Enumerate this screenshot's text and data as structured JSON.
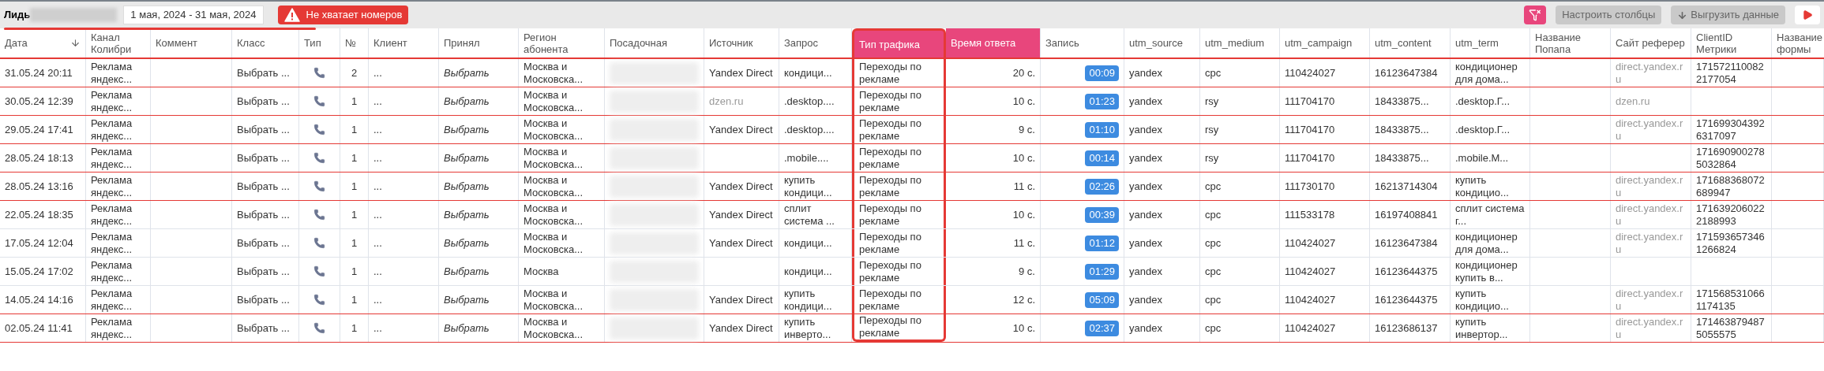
{
  "toolbar": {
    "title": "Лидь",
    "underlined": true,
    "period": "1 мая, 2024 - 31 мая, 2024",
    "alert": "Не хватает номеров",
    "buttons": [
      {
        "kind": "filter-clear"
      },
      {
        "kind": "text",
        "label": "Настроить столбцы"
      },
      {
        "kind": "download",
        "label": "Выгрузить данные"
      },
      {
        "kind": "play"
      }
    ]
  },
  "table": {
    "columns": [
      {
        "label": "Дата",
        "kind": "text",
        "sorted": true
      },
      {
        "label": "Канал Колибри",
        "kind": "text"
      },
      {
        "label": "Коммент"
      },
      {
        "label": "Класс",
        "kind": "text"
      },
      {
        "label": "Тип"
      },
      {
        "label": "№",
        "kind": "number"
      },
      {
        "label": "Клиент",
        "kind": "text"
      },
      {
        "label": "Принял",
        "kind": "italic"
      },
      {
        "label": "Регион абонента",
        "kind": "text"
      },
      {
        "label": "Посадочная"
      },
      {
        "label": "Источник",
        "kind": "text"
      },
      {
        "label": "Запрос",
        "kind": "text"
      },
      {
        "label": "Тип трафика",
        "kind": "text",
        "highlighted": true,
        "framed": true
      },
      {
        "label": "Время ответа",
        "kind": "right",
        "highlighted": true
      },
      {
        "label": "Запись",
        "kind": "record"
      },
      {
        "label": "utm_source",
        "kind": "text"
      },
      {
        "label": "utm_medium",
        "kind": "text"
      },
      {
        "label": "utm_campaign",
        "kind": "text"
      },
      {
        "label": "utm_content",
        "kind": "text"
      },
      {
        "label": "utm_term",
        "kind": "text"
      },
      {
        "label": "Название Попапа"
      },
      {
        "label": "Сайт реферер",
        "kind": "muted"
      },
      {
        "label": "ClientID Метрики",
        "kind": "break"
      },
      {
        "label": "Название формы"
      }
    ],
    "rows": [
      {
        "marked": true,
        "cells": [
          "31.05.24 20:11",
          "Реклама яндекс...",
          {
            "kind": "blank"
          },
          "Выбрать ...",
          {
            "kind": "phone"
          },
          "2",
          "...",
          "Выбрать",
          "Москва и Московска...",
          {
            "kind": "redacted"
          },
          "Yandex Direct",
          "кондици...",
          "Переходы по рекламе",
          "20 с.",
          "00:09",
          "yandex",
          "cpc",
          "110424027",
          "16123647384",
          "кондиционер для дома...",
          {
            "kind": "blank"
          },
          "direct.yandex.ru",
          "1715721100822177054",
          {
            "kind": "blank"
          }
        ]
      },
      {
        "marked": true,
        "cells": [
          "30.05.24 12:39",
          "Реклама яндекс...",
          {
            "kind": "blank"
          },
          "Выбрать ...",
          {
            "kind": "phone"
          },
          "1",
          "...",
          "Выбрать",
          "Москва и Московска...",
          {
            "kind": "redacted"
          },
          {
            "kind": "muted",
            "text": "dzen.ru"
          },
          ".desktop....",
          "Переходы по рекламе",
          "10 с.",
          "01:23",
          "yandex",
          "rsy",
          "111704170",
          "18433875...",
          ".desktop.Г...",
          {
            "kind": "blank"
          },
          "dzen.ru",
          {
            "kind": "blank"
          },
          {
            "kind": "blank"
          }
        ]
      },
      {
        "marked": true,
        "cells": [
          "29.05.24 17:41",
          "Реклама яндекс...",
          {
            "kind": "blank"
          },
          "Выбрать ...",
          {
            "kind": "phone"
          },
          "1",
          "...",
          "Выбрать",
          "Москва и Московска...",
          {
            "kind": "redacted"
          },
          "Yandex Direct",
          ".desktop....",
          "Переходы по рекламе",
          "9 с.",
          "01:10",
          "yandex",
          "rsy",
          "111704170",
          "18433875...",
          ".desktop.Г...",
          {
            "kind": "blank"
          },
          "direct.yandex.ru",
          "1716993043926317097",
          {
            "kind": "blank"
          }
        ]
      },
      {
        "marked": true,
        "cells": [
          "28.05.24 18:13",
          "Реклама яндекс...",
          {
            "kind": "blank"
          },
          "Выбрать ...",
          {
            "kind": "phone"
          },
          "1",
          "...",
          "Выбрать",
          "Москва и Московска...",
          {
            "kind": "redacted"
          },
          {
            "kind": "blank"
          },
          ".mobile....",
          "Переходы по рекламе",
          "10 с.",
          "00:14",
          "yandex",
          "rsy",
          "111704170",
          "18433875...",
          ".mobile.M...",
          {
            "kind": "blank"
          },
          {
            "kind": "blank"
          },
          "1716909002785032864",
          {
            "kind": "blank"
          }
        ]
      },
      {
        "marked": true,
        "cells": [
          "28.05.24 13:16",
          "Реклама яндекс...",
          {
            "kind": "blank"
          },
          "Выбрать ...",
          {
            "kind": "phone"
          },
          "1",
          "...",
          "Выбрать",
          "Москва и Московска...",
          {
            "kind": "redacted"
          },
          "Yandex Direct",
          "купить кондици...",
          "Переходы по рекламе",
          "11 с.",
          "02:26",
          "yandex",
          "cpc",
          "111730170",
          "16213714304",
          "купить кондицио...",
          {
            "kind": "blank"
          },
          "direct.yandex.ru",
          "171688368072689947",
          {
            "kind": "blank"
          }
        ]
      },
      {
        "marked": false,
        "cells": [
          "22.05.24 18:35",
          "Реклама яндекс...",
          {
            "kind": "blank"
          },
          "Выбрать ...",
          {
            "kind": "phone"
          },
          "1",
          "...",
          "Выбрать",
          "Москва и Московска...",
          {
            "kind": "redacted"
          },
          "Yandex Direct",
          "сплит система ...",
          "Переходы по рекламе",
          "10 с.",
          "00:39",
          "yandex",
          "cpc",
          "111533178",
          "16197408841",
          "сплит система г...",
          {
            "kind": "blank"
          },
          "direct.yandex.ru",
          "1716392060222188993",
          {
            "kind": "blank"
          }
        ]
      },
      {
        "marked": false,
        "cells": [
          "17.05.24 12:04",
          "Реклама яндекс...",
          {
            "kind": "blank"
          },
          "Выбрать ...",
          {
            "kind": "phone"
          },
          "1",
          "...",
          "Выбрать",
          "Москва и Московска...",
          {
            "kind": "redacted"
          },
          "Yandex Direct",
          "кондици...",
          "Переходы по рекламе",
          "11 с.",
          "01:12",
          "yandex",
          "cpc",
          "110424027",
          "16123647384",
          "кондиционер для дома...",
          {
            "kind": "blank"
          },
          "direct.yandex.ru",
          "1715936573461266824",
          {
            "kind": "blank"
          }
        ]
      },
      {
        "marked": false,
        "cells": [
          "15.05.24 17:02",
          "Реклама яндекс...",
          {
            "kind": "blank"
          },
          "Выбрать ...",
          {
            "kind": "phone"
          },
          "1",
          "...",
          "Выбрать",
          "Москва",
          {
            "kind": "redacted"
          },
          {
            "kind": "blank"
          },
          "кондици...",
          "Переходы по рекламе",
          "9 с.",
          "01:29",
          "yandex",
          "cpc",
          "110424027",
          "16123644375",
          "кондиционер купить в...",
          {
            "kind": "blank"
          },
          {
            "kind": "blank"
          },
          {
            "kind": "blank"
          },
          {
            "kind": "blank"
          }
        ]
      },
      {
        "marked": true,
        "cells": [
          "14.05.24 14:16",
          "Реклама яндекс...",
          {
            "kind": "blank"
          },
          "Выбрать ...",
          {
            "kind": "phone"
          },
          "1",
          "...",
          "Выбрать",
          "Москва и Московска...",
          {
            "kind": "redacted"
          },
          "Yandex Direct",
          "купить кондици...",
          "Переходы по рекламе",
          "12 с.",
          "05:09",
          "yandex",
          "cpc",
          "110424027",
          "16123644375",
          "купить кондицио...",
          {
            "kind": "blank"
          },
          "direct.yandex.ru",
          "1715685310661174135",
          {
            "kind": "blank"
          }
        ]
      },
      {
        "marked": true,
        "cells": [
          "02.05.24 11:41",
          "Реклама яндекс...",
          {
            "kind": "blank"
          },
          "Выбрать ...",
          {
            "kind": "phone"
          },
          "1",
          "...",
          "Выбрать",
          "Москва и Московска...",
          {
            "kind": "redacted"
          },
          "Yandex Direct",
          "купить инверто...",
          "Переходы по рекламе",
          "10 с.",
          "02:37",
          "yandex",
          "cpc",
          "110424027",
          "16123686137",
          "купить инвертор...",
          {
            "kind": "blank"
          },
          "direct.yandex.ru",
          "1714638794875055575",
          {
            "kind": "blank"
          }
        ]
      }
    ]
  }
}
